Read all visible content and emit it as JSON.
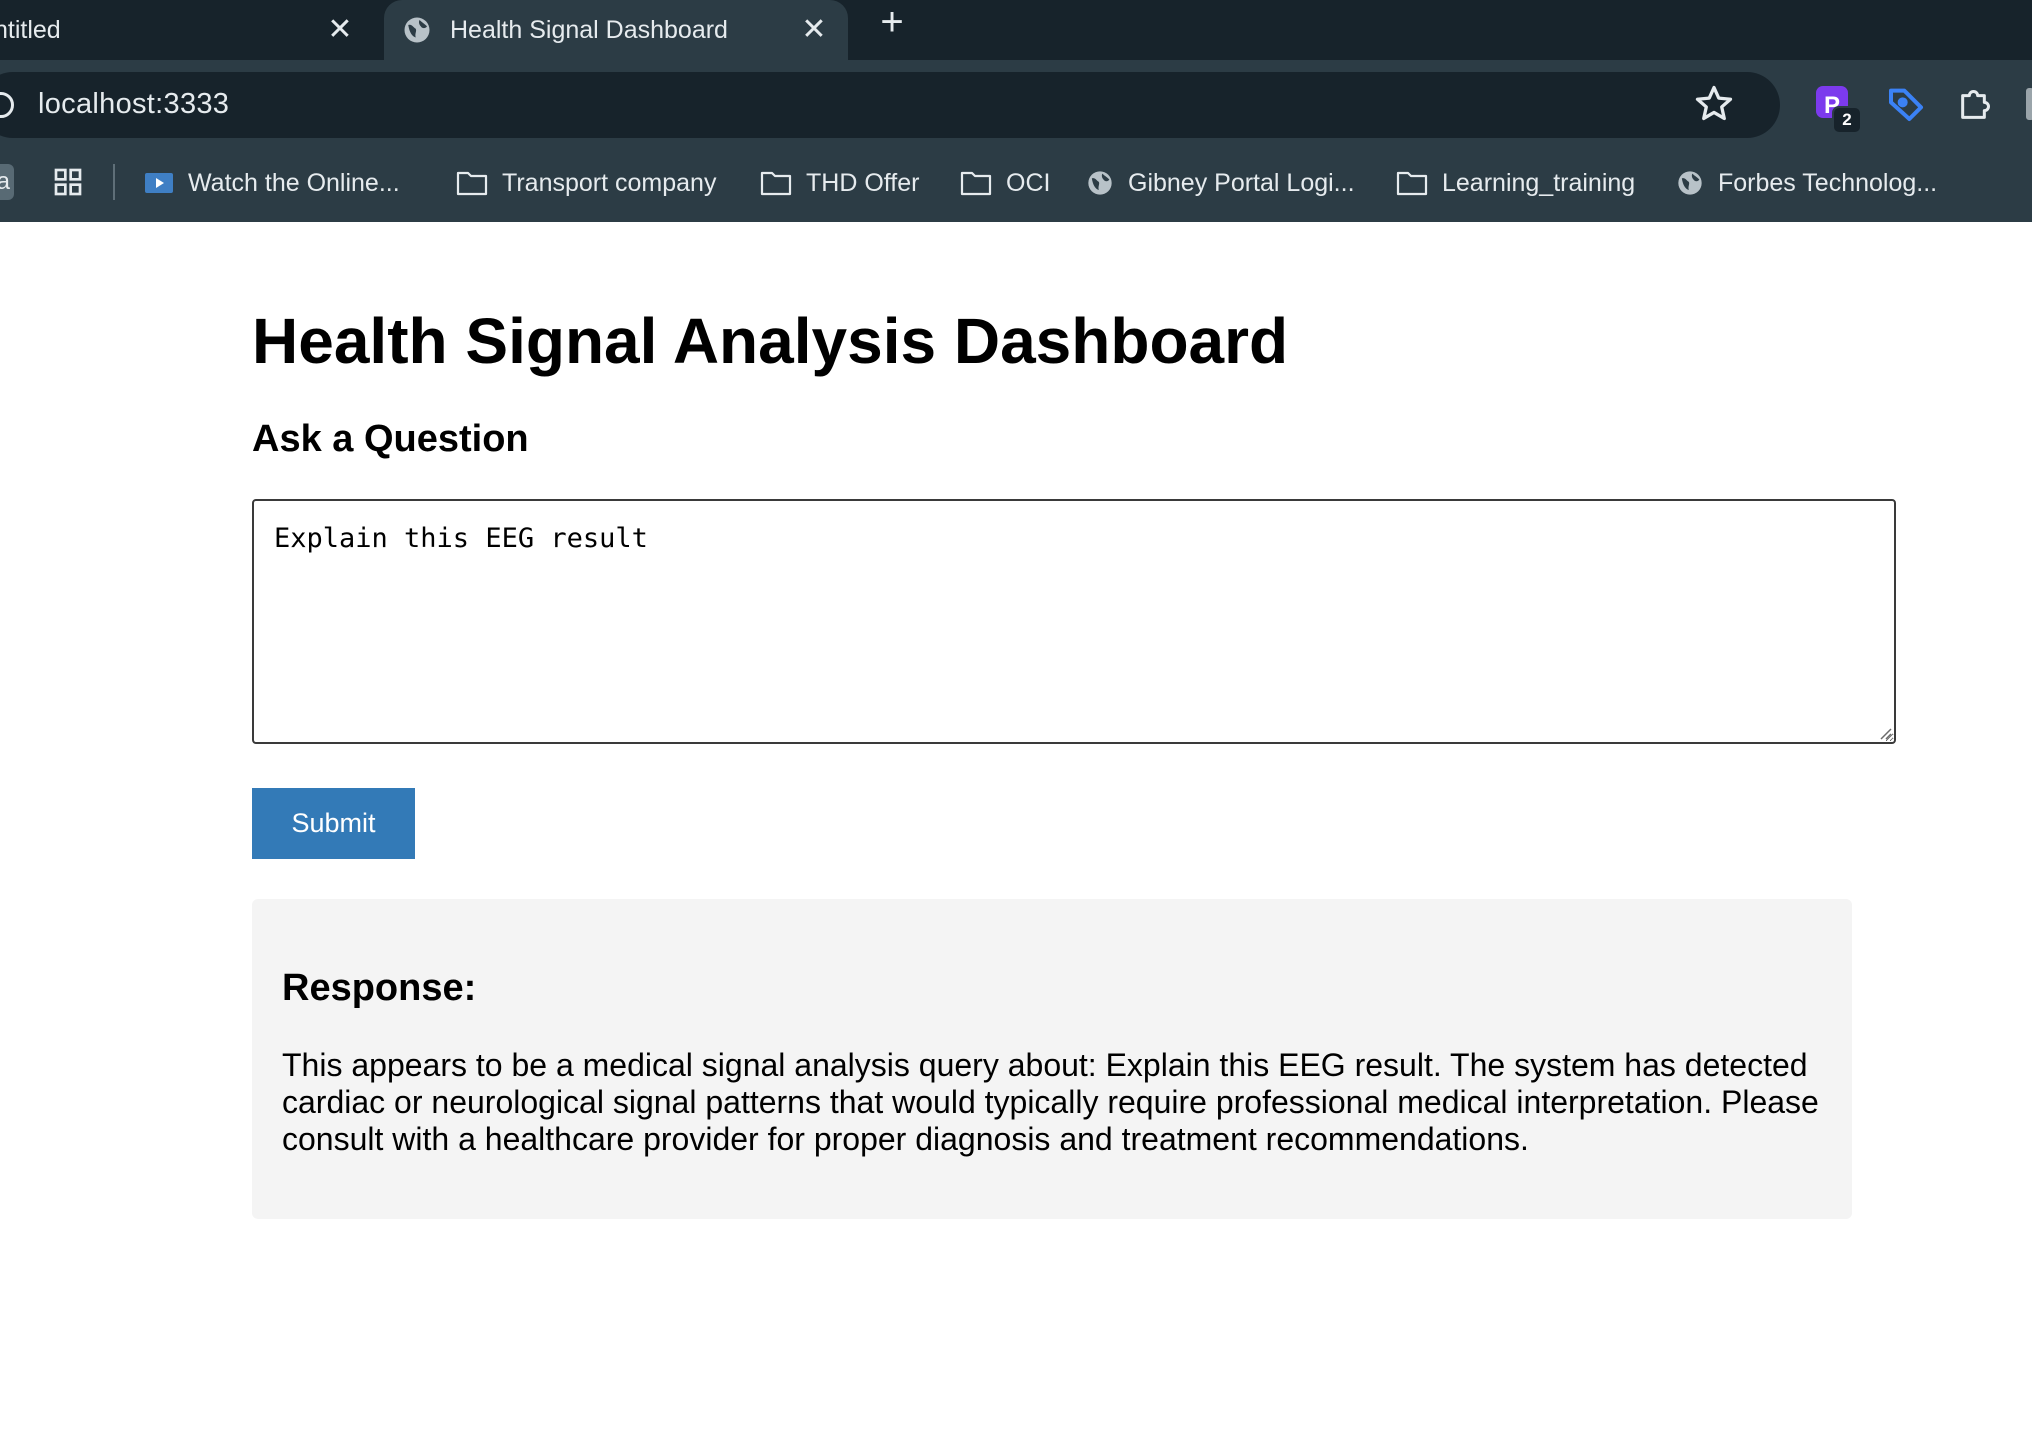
{
  "browser": {
    "tabs": [
      {
        "title": "ntitled",
        "close": "✕",
        "active": false
      },
      {
        "title": "Health Signal Dashboard",
        "close": "✕",
        "active": true
      }
    ],
    "new_tab": "+",
    "url": "localhost:3333",
    "bookmark_stub": "a",
    "extensions": [
      {
        "icon": "purple-p-extension-icon",
        "label": "P",
        "badge": "2",
        "color": "#7c3aed"
      },
      {
        "icon": "blue-tag-extension-icon",
        "color": "#3b82f6"
      },
      {
        "icon": "puzzle-extensions-icon"
      }
    ],
    "bookmarks": [
      {
        "icon": "video-icon",
        "label": "Watch the Online..."
      },
      {
        "icon": "folder-icon",
        "label": "Transport company"
      },
      {
        "icon": "folder-icon",
        "label": "THD Offer"
      },
      {
        "icon": "folder-icon",
        "label": "OCI"
      },
      {
        "icon": "globe-icon",
        "label": "Gibney Portal Logi..."
      },
      {
        "icon": "folder-icon",
        "label": "Learning_training"
      },
      {
        "icon": "globe-icon",
        "label": "Forbes Technolog..."
      }
    ]
  },
  "page": {
    "title": "Health Signal Analysis Dashboard",
    "question_heading": "Ask a Question",
    "question_value": "Explain this EEG result",
    "submit_label": "Submit",
    "response_heading": "Response:",
    "response_text": "This appears to be a medical signal analysis query about: Explain this EEG result. The system has detected cardiac or neurological signal patterns that would typically require professional medical interpretation. Please consult with a healthcare provider for proper diagnosis and treatment recommendations.",
    "colors": {
      "submit_background": "#337ab7",
      "response_background": "#f4f4f4",
      "chrome_dark": "#17232b",
      "chrome_light": "#2c3c45"
    }
  }
}
